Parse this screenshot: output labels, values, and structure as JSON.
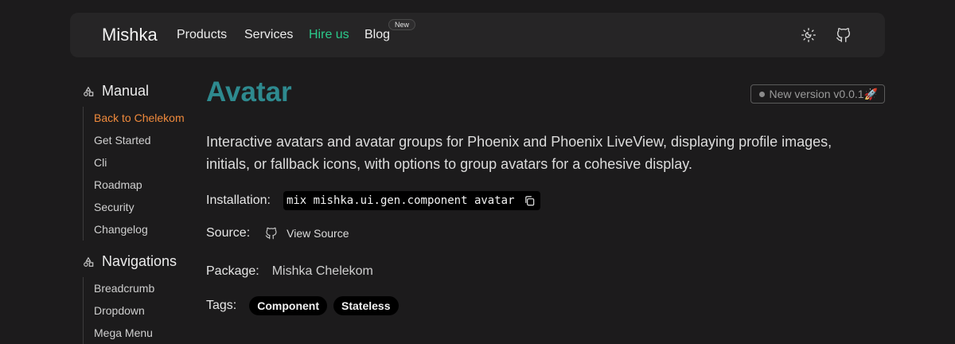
{
  "navbar": {
    "brand": "Mishka",
    "links": [
      "Products",
      "Services",
      "Hire us",
      "Blog"
    ],
    "blog_badge": "New",
    "accent_color": "#2bc98b",
    "icons": [
      "theme-toggle-icon",
      "github-icon"
    ]
  },
  "sidebar": {
    "sections": [
      {
        "title": "Manual",
        "icon": "shapes-icon",
        "items": [
          "Back to Chelekom",
          "Get Started",
          "Cli",
          "Roadmap",
          "Security",
          "Changelog"
        ],
        "active_index": 0
      },
      {
        "title": "Navigations",
        "icon": "shapes-icon",
        "items": [
          "Breadcrumb",
          "Dropdown",
          "Mega Menu"
        ]
      }
    ],
    "active_color": "#f08a3c"
  },
  "main": {
    "title": "Avatar",
    "title_color": "#2e8a8f",
    "version_badge": "New version v0.0.1",
    "version_emoji": "🚀",
    "description": "Interactive avatars and avatar groups for Phoenix and Phoenix LiveView, displaying profile images, initials, or fallback icons, with options to group avatars for a cohesive display.",
    "installation": {
      "label": "Installation:",
      "command": "mix mishka.ui.gen.component avatar"
    },
    "source": {
      "label": "Source:",
      "link_text": "View Source"
    },
    "package": {
      "label": "Package:",
      "value": "Mishka Chelekom"
    },
    "tags": {
      "label": "Tags:",
      "items": [
        "Component",
        "Stateless"
      ]
    }
  }
}
